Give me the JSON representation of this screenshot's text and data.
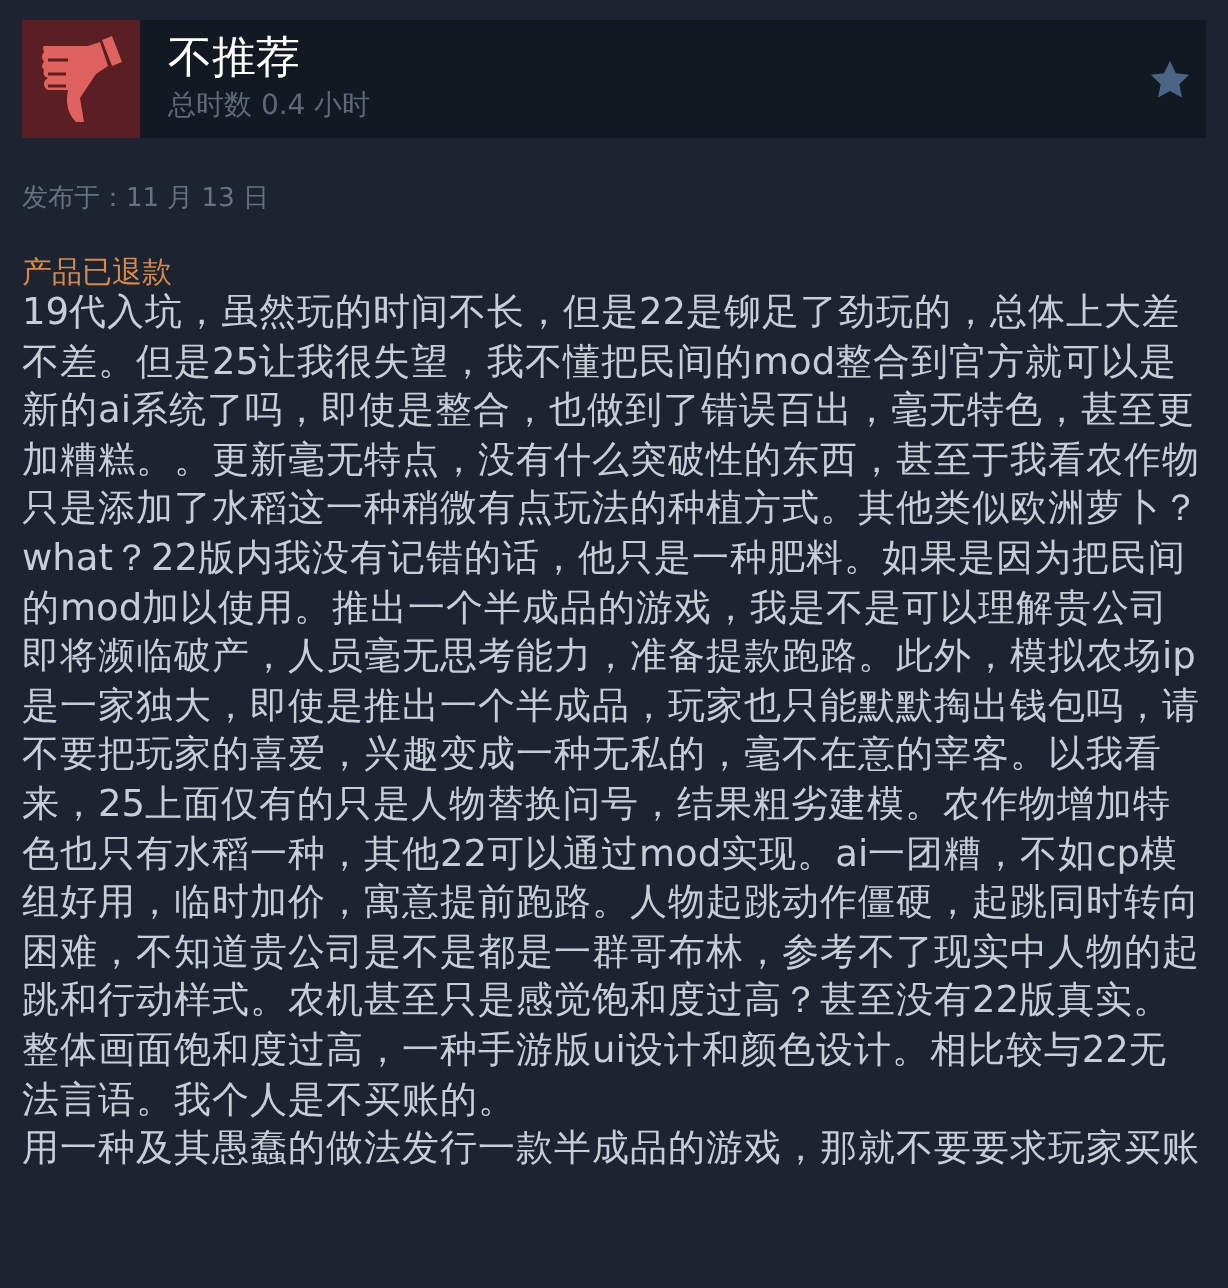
{
  "review": {
    "verdict": "不推荐",
    "playtime": "总时数 0.4 小时",
    "posted": "发布于：11 月 13 日",
    "refund_notice": "产品已退款",
    "paragraphs": [
      "19代入坑，虽然玩的时间不长，但是22是铆足了劲玩的，总体上大差不差。但是25让我很失望，我不懂把民间的mod整合到官方就可以是新的ai系统了吗，即使是整合，也做到了错误百出，毫无特色，甚至更加糟糕。。更新毫无特点，没有什么突破性的东西，甚至于我看农作物只是添加了水稻这一种稍微有点玩法的种植方式。其他类似欧洲萝卜？what？22版内我没有记错的话，他只是一种肥料。如果是因为把民间的mod加以使用。推出一个半成品的游戏，我是不是可以理解贵公司即将濒临破产，人员毫无思考能力，准备提款跑路。此外，模拟农场ip是一家独大，即使是推出一个半成品，玩家也只能默默掏出钱包吗，请不要把玩家的喜爱，兴趣变成一种无私的，毫不在意的宰客。以我看来，25上面仅有的只是人物替换问号，结果粗劣建模。农作物增加特色也只有水稻一种，其他22可以通过mod实现。ai一团糟，不如cp模组好用，临时加价，寓意提前跑路。人物起跳动作僵硬，起跳同时转向困难，不知道贵公司是不是都是一群哥布林，参考不了现实中人物的起跳和行动样式。农机甚至只是感觉饱和度过高？甚至没有22版真实。整体画面饱和度过高，一种手游版ui设计和颜色设计。相比较与22无法言语。我个人是不买账的。",
      "用一种及其愚蠢的做法发行一款半成品的游戏，那就不要要求玩家买账"
    ]
  }
}
